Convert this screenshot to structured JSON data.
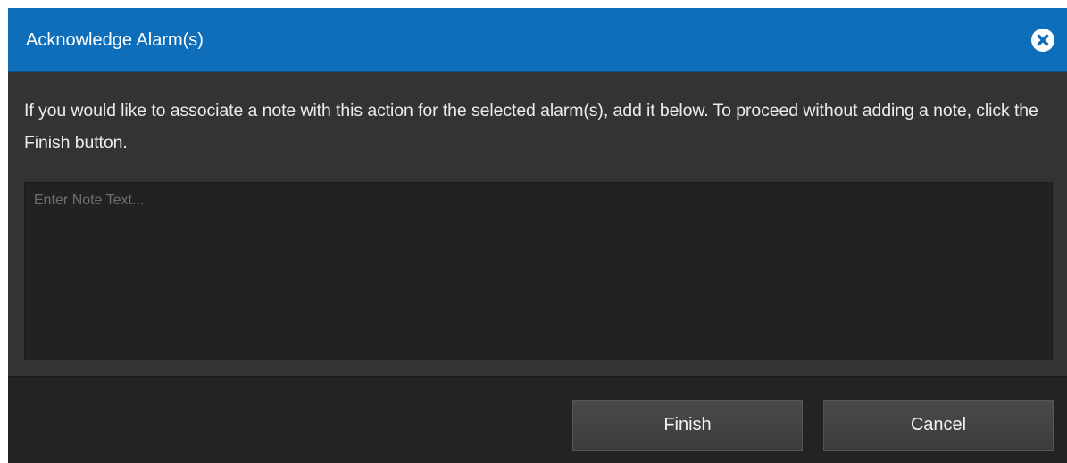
{
  "dialog": {
    "title": "Acknowledge Alarm(s)",
    "close_icon": "close-circle-icon",
    "message": "If you would like to associate a note with this action for the selected alarm(s), add it below. To proceed without adding a note, click the Finish button.",
    "note": {
      "value": "",
      "placeholder": "Enter Note Text..."
    },
    "buttons": {
      "finish_label": "Finish",
      "cancel_label": "Cancel"
    }
  },
  "colors": {
    "titlebar": "#0f6eb9",
    "body": "#333333",
    "footer": "#232323",
    "input": "#222222"
  }
}
